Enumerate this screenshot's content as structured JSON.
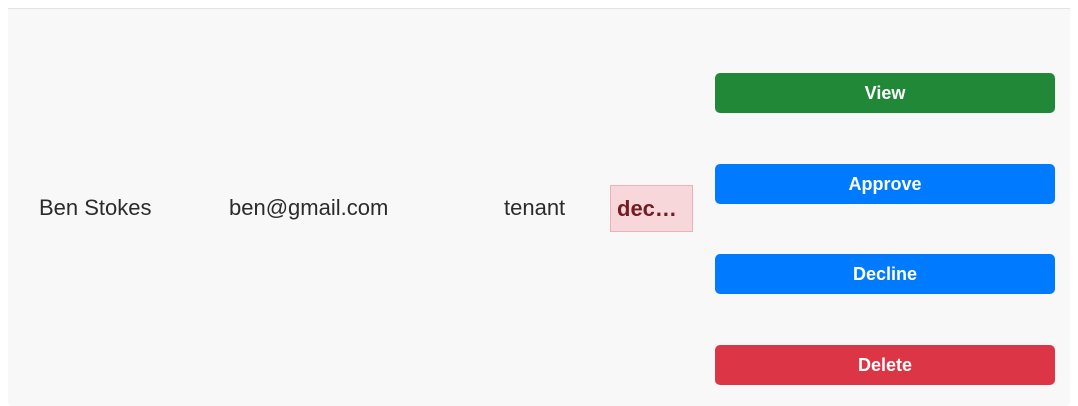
{
  "row": {
    "name": "Ben Stokes",
    "email": "ben@gmail.com",
    "role": "tenant",
    "status": "dec…"
  },
  "actions": {
    "view_label": "View",
    "approve_label": "Approve",
    "decline_label": "Decline",
    "delete_label": "Delete"
  },
  "colors": {
    "view": "#218838",
    "approve": "#007bff",
    "decline": "#007bff",
    "delete": "#dc3545",
    "status_bg": "#f8d7da",
    "status_text": "#721c24"
  }
}
